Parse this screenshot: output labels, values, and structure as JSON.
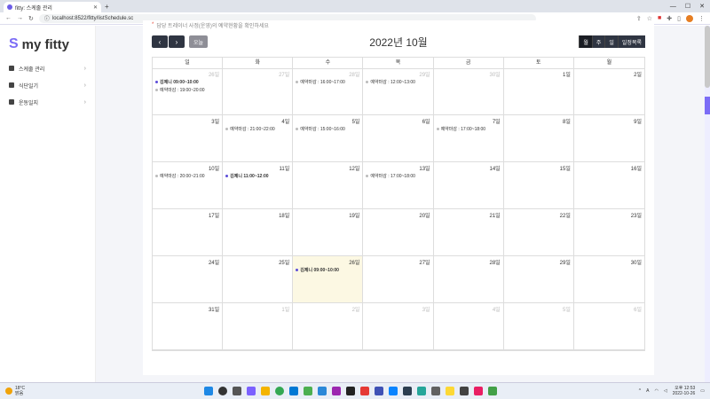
{
  "browser": {
    "tab_title": "fitty: 스케줄 관리",
    "new_tab": "+",
    "url": "localhost:8522/fitty/listSchedule.sc"
  },
  "sidebar": {
    "logo_text": "my fitty",
    "items": [
      {
        "label": "스케줄 관리"
      },
      {
        "label": "식단일기"
      },
      {
        "label": "운동일지"
      }
    ]
  },
  "main": {
    "notice": "담당 트레이너 사정(운영)의 예약현황을 확인하세요",
    "prev_label": "‹",
    "next_label": "›",
    "today_label": "오늘",
    "title": "2022년 10월",
    "views": [
      "월",
      "주",
      "일",
      "일정목록"
    ],
    "weekdays": [
      "일",
      "화",
      "수",
      "목",
      "금",
      "토",
      "월"
    ]
  },
  "calendar": {
    "weeks": [
      [
        {
          "d": "26일",
          "muted": true,
          "events": [
            {
              "t": "김제니 09:00~10:00",
              "major": true
            },
            {
              "t": "예약마감 : 19:00~20:00",
              "major": false
            }
          ]
        },
        {
          "d": "27일",
          "muted": true,
          "events": []
        },
        {
          "d": "28일",
          "muted": true,
          "events": [
            {
              "t": "예약마감 : 16:00~17:00",
              "major": false
            }
          ]
        },
        {
          "d": "29일",
          "muted": true,
          "events": [
            {
              "t": "예약마감 : 12:00~13:00",
              "major": false
            }
          ]
        },
        {
          "d": "30일",
          "muted": true,
          "events": []
        },
        {
          "d": "1일",
          "muted": false,
          "events": []
        },
        {
          "d": "2일",
          "muted": false,
          "events": []
        }
      ],
      [
        {
          "d": "3일",
          "muted": false,
          "events": []
        },
        {
          "d": "4일",
          "muted": false,
          "events": [
            {
              "t": "예약마감 : 21:00~22:00",
              "major": false
            }
          ]
        },
        {
          "d": "5일",
          "muted": false,
          "events": [
            {
              "t": "예약마감 : 15:00~16:00",
              "major": false
            }
          ]
        },
        {
          "d": "6일",
          "muted": false,
          "events": []
        },
        {
          "d": "7일",
          "muted": false,
          "events": [
            {
              "t": "예약마감 : 17:00~18:00",
              "major": false
            }
          ]
        },
        {
          "d": "8일",
          "muted": false,
          "events": []
        },
        {
          "d": "9일",
          "muted": false,
          "events": []
        }
      ],
      [
        {
          "d": "10일",
          "muted": false,
          "events": [
            {
              "t": "예약마감 : 20:00~21:00",
              "major": false
            }
          ]
        },
        {
          "d": "11일",
          "muted": false,
          "events": [
            {
              "t": "김제니 11:00~12:00",
              "major": true
            }
          ]
        },
        {
          "d": "12일",
          "muted": false,
          "events": []
        },
        {
          "d": "13일",
          "muted": false,
          "events": [
            {
              "t": "예약마감 : 17:00~18:00",
              "major": false
            }
          ]
        },
        {
          "d": "14일",
          "muted": false,
          "events": []
        },
        {
          "d": "15일",
          "muted": false,
          "events": []
        },
        {
          "d": "16일",
          "muted": false,
          "events": []
        }
      ],
      [
        {
          "d": "17일",
          "muted": false,
          "events": []
        },
        {
          "d": "18일",
          "muted": false,
          "events": []
        },
        {
          "d": "19일",
          "muted": false,
          "events": []
        },
        {
          "d": "20일",
          "muted": false,
          "events": []
        },
        {
          "d": "21일",
          "muted": false,
          "events": []
        },
        {
          "d": "22일",
          "muted": false,
          "events": []
        },
        {
          "d": "23일",
          "muted": false,
          "events": []
        }
      ],
      [
        {
          "d": "24일",
          "muted": false,
          "events": []
        },
        {
          "d": "25일",
          "muted": false,
          "events": []
        },
        {
          "d": "26일",
          "muted": false,
          "today": true,
          "events": [
            {
              "t": "김제니 09:00~10:00",
              "major": true
            }
          ]
        },
        {
          "d": "27일",
          "muted": false,
          "events": []
        },
        {
          "d": "28일",
          "muted": false,
          "events": []
        },
        {
          "d": "29일",
          "muted": false,
          "events": []
        },
        {
          "d": "30일",
          "muted": false,
          "events": []
        }
      ],
      [
        {
          "d": "31일",
          "muted": false,
          "events": []
        },
        {
          "d": "1일",
          "muted": true,
          "events": []
        },
        {
          "d": "2일",
          "muted": true,
          "events": []
        },
        {
          "d": "3일",
          "muted": true,
          "events": []
        },
        {
          "d": "4일",
          "muted": true,
          "events": []
        },
        {
          "d": "5일",
          "muted": true,
          "events": []
        },
        {
          "d": "6일",
          "muted": true,
          "events": []
        }
      ]
    ]
  },
  "taskbar": {
    "weather_temp": "18°C",
    "weather_desc": "맑음",
    "time": "오후 12:53",
    "date": "2022-10-26",
    "lang": "A"
  },
  "colors": {
    "accent": "#7b6cf6",
    "today_bg": "#fcf8e3",
    "nav_dark": "#2f3542"
  }
}
